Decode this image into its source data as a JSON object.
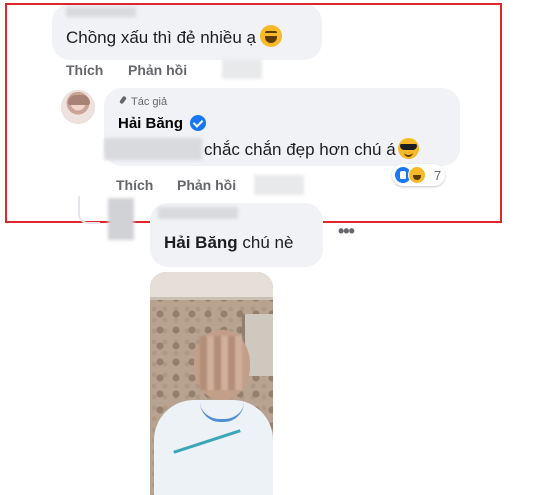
{
  "comment1": {
    "text": "Chồng xấu thì đẻ nhiều ạ",
    "actions": {
      "like": "Thích",
      "reply": "Phản hồi"
    }
  },
  "comment2": {
    "author_badge": "Tác giả",
    "author_name": "Hải Băng",
    "text": "chắc chắn đẹp hơn chú á",
    "reaction_count": "7",
    "actions": {
      "like": "Thích",
      "reply": "Phản hồi"
    }
  },
  "comment3": {
    "mention": "Hải Băng",
    "text": "chú nè",
    "more": "•••"
  },
  "colors": {
    "highlight_border": "#e0262b",
    "bubble_bg": "#f0f2f5",
    "facebook_blue": "#1877f2",
    "secondary_text": "#65676b"
  },
  "icons": [
    "laugh-emoji-icon",
    "pencil-icon",
    "verified-badge-icon",
    "sunglasses-emoji-icon",
    "like-reaction-icon",
    "haha-reaction-icon",
    "more-dots-icon"
  ]
}
